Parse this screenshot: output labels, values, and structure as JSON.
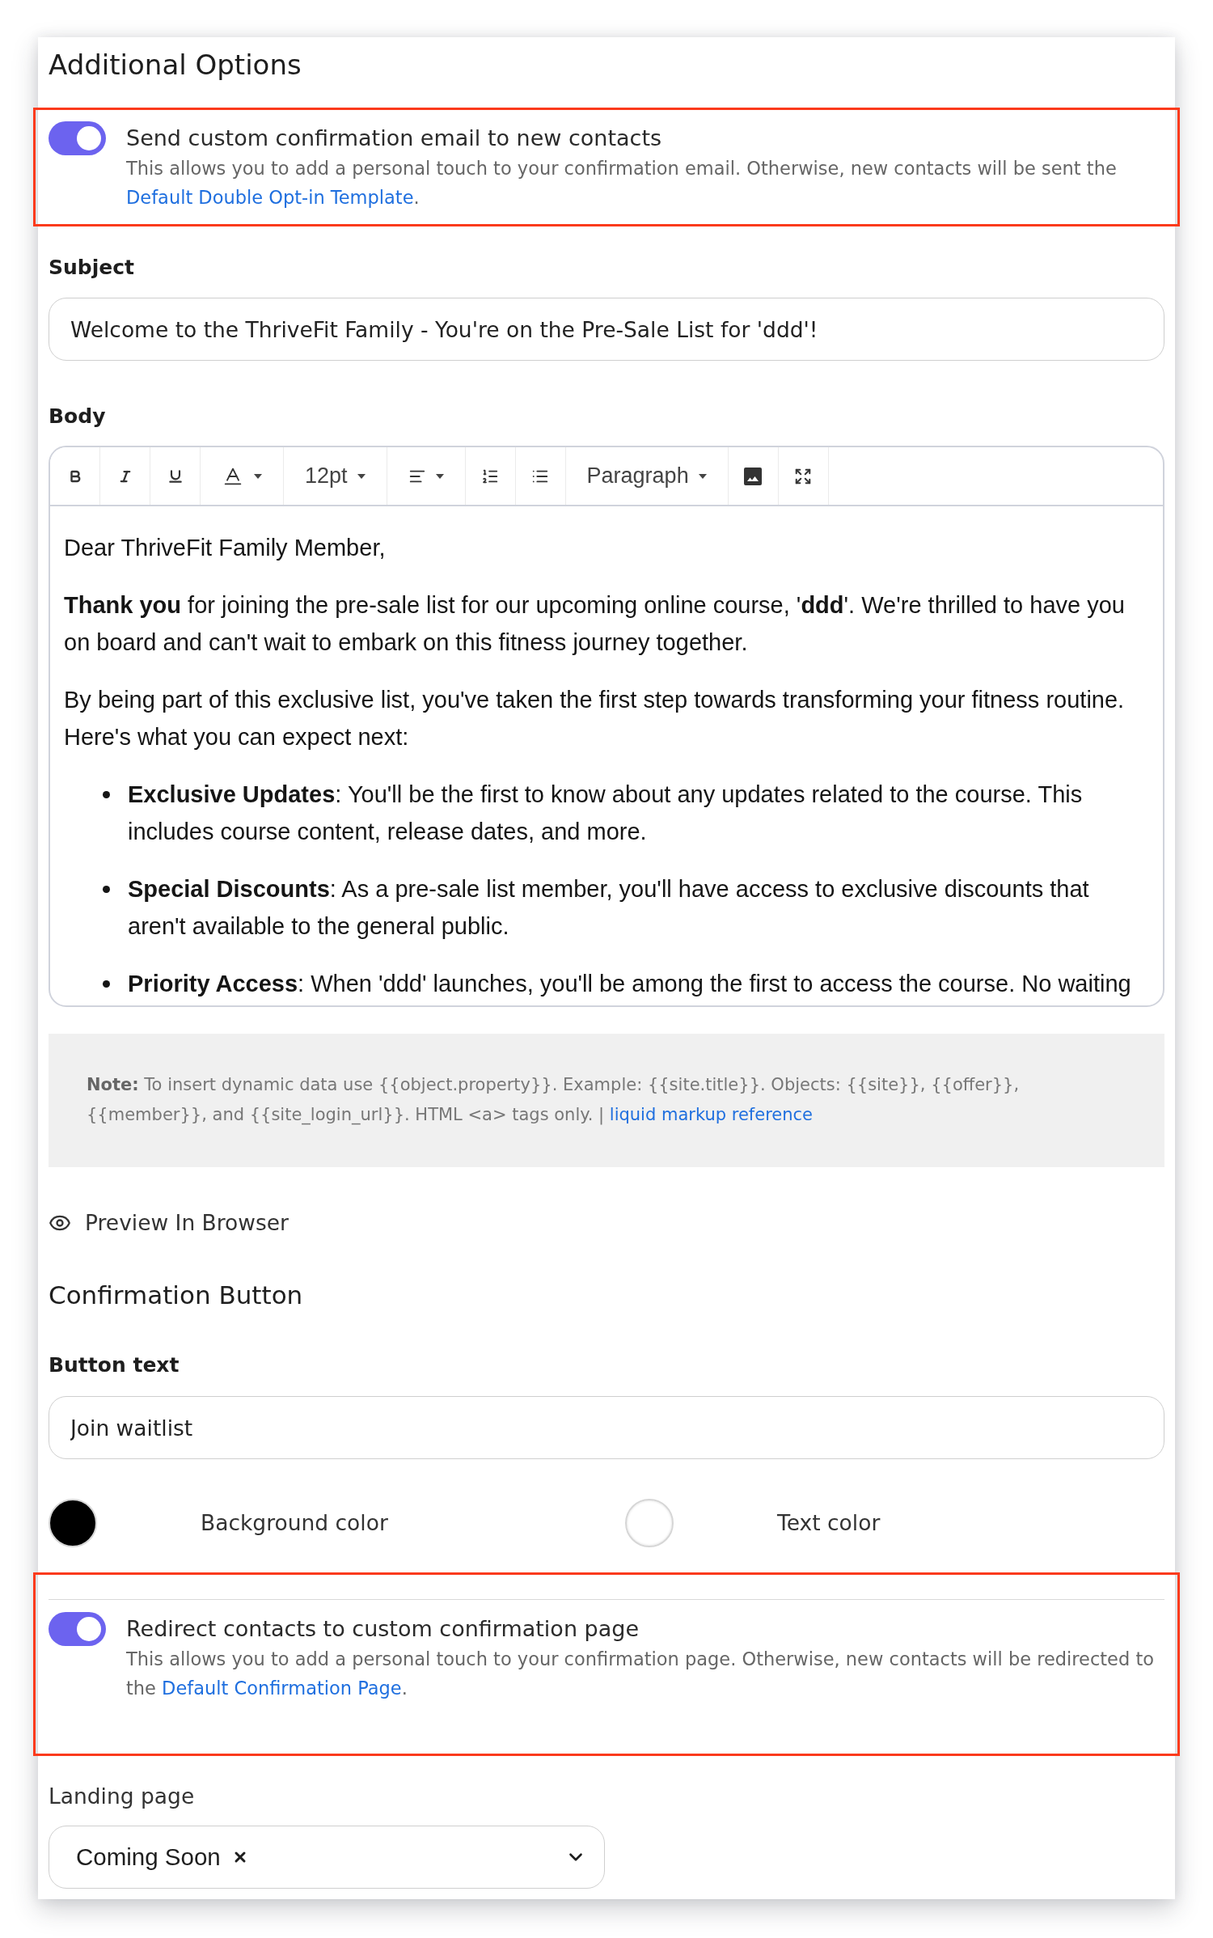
{
  "section": {
    "title": "Additional Options"
  },
  "email_option": {
    "on": true,
    "label": "Send custom confirmation email to new contacts",
    "description": "This allows you to add a personal touch to your confirmation email. Otherwise, new contacts will be sent the",
    "link": "Default Double Opt-in Template",
    "after_link": "."
  },
  "subject": {
    "label": "Subject",
    "value": "Welcome to the ThriveFit Family - You're on the Pre-Sale List for 'ddd'!"
  },
  "body": {
    "label": "Body",
    "toolbar": [
      {
        "kind": "bold",
        "dropdown": false
      },
      {
        "kind": "italic",
        "dropdown": false
      },
      {
        "kind": "underline",
        "dropdown": false
      },
      {
        "kind": "text-color",
        "dropdown": true
      },
      {
        "kind": "font-size",
        "label": "12pt",
        "dropdown": true
      },
      {
        "kind": "align",
        "dropdown": true
      },
      {
        "kind": "ordered-list",
        "dropdown": false
      },
      {
        "kind": "bullet-list",
        "dropdown": false
      },
      {
        "kind": "block-format",
        "label": "Paragraph",
        "dropdown": true
      },
      {
        "kind": "image",
        "dropdown": false
      },
      {
        "kind": "fullscreen",
        "dropdown": false
      }
    ],
    "content": [
      {
        "kind": "paragraph",
        "text": "Dear ThriveFit Family Member,"
      },
      {
        "kind": "paragraph",
        "text": "**Thank you** for joining the pre-sale list for our upcoming online course, '**ddd**'. We're thrilled to have you on board and can't wait to embark on this fitness journey together."
      },
      {
        "kind": "paragraph",
        "text": "By being part of this exclusive list, you've taken the first step towards transforming your fitness routine. Here's what you can expect next:"
      },
      {
        "kind": "bullet",
        "text": "**Exclusive Updates**: You'll be the first to know about any updates related to the course. This includes course content, release dates, and more."
      },
      {
        "kind": "bullet",
        "text": "**Special Discounts**: As a pre-sale list member, you'll have access to exclusive discounts that aren't available to the general public."
      },
      {
        "kind": "bullet",
        "text": "**Priority Access**: When 'ddd' launches, you'll be among the first to access the course. No waiting"
      }
    ]
  },
  "note": {
    "text": "**Note:** To insert dynamic data use {{object.property}}. Example: {{site.title}}. Objects: {{site}}, {{offer}}, {{member}}, and {{site_login_url}}. HTML <a> tags only. |",
    "link": "liquid markup reference"
  },
  "preview": {
    "label": "Preview In Browser"
  },
  "confirmation_button": {
    "title": "Confirmation Button",
    "text_label": "Button text",
    "text_value": "Join waitlist",
    "colors": [
      {
        "label": "Background color",
        "color": "#000000"
      },
      {
        "label": "Text color",
        "color": "#ffffff"
      }
    ]
  },
  "redirect_option": {
    "on": true,
    "label": "Redirect contacts to custom confirmation page",
    "description": "This allows you to add a personal touch to your confirmation page. Otherwise, new contacts will be redirected to the",
    "link": "Default Confirmation Page",
    "after_link": "."
  },
  "landing_page": {
    "label": "Landing page",
    "value": "Coming Soon"
  }
}
